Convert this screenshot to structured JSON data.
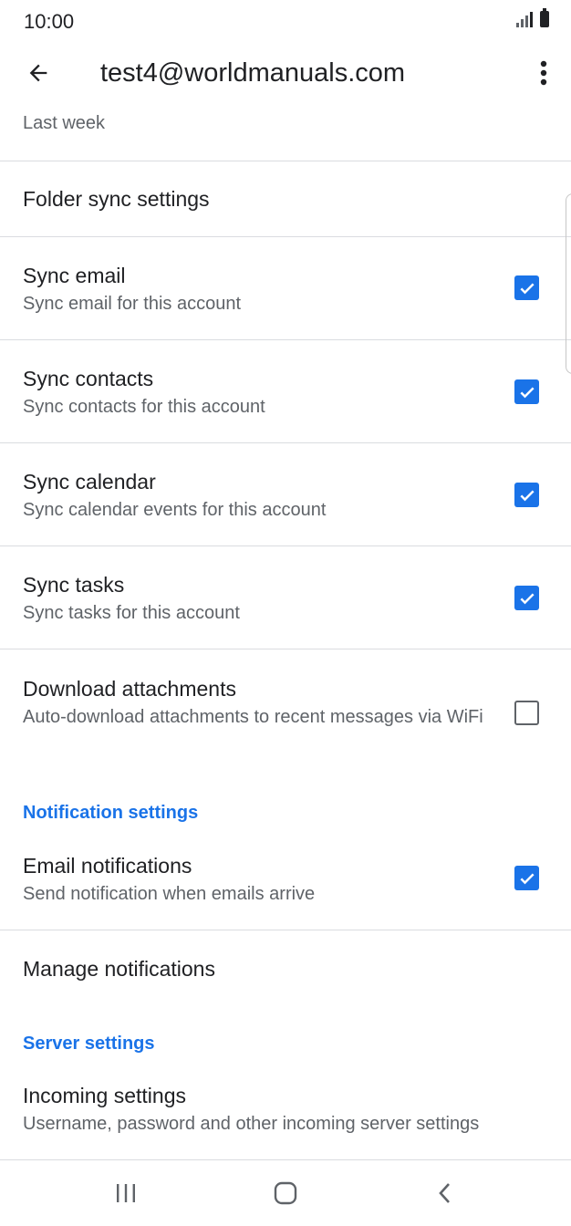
{
  "status_bar": {
    "time": "10:00"
  },
  "app_bar": {
    "title": "test4@worldmanuals.com"
  },
  "partial_value": "Last week",
  "folder_sync": {
    "title": "Folder sync settings"
  },
  "sync_email": {
    "title": "Sync email",
    "subtitle": "Sync email for this account",
    "checked": true
  },
  "sync_contacts": {
    "title": "Sync contacts",
    "subtitle": "Sync contacts for this account",
    "checked": true
  },
  "sync_calendar": {
    "title": "Sync calendar",
    "subtitle": "Sync calendar events for this account",
    "checked": true
  },
  "sync_tasks": {
    "title": "Sync tasks",
    "subtitle": "Sync tasks for this account",
    "checked": true
  },
  "download_attachments": {
    "title": "Download attachments",
    "subtitle": "Auto-download attachments to recent messages via WiFi",
    "checked": false
  },
  "notification_section": {
    "header": "Notification settings"
  },
  "email_notifications": {
    "title": "Email notifications",
    "subtitle": "Send notification when emails arrive",
    "checked": true
  },
  "manage_notifications": {
    "title": "Manage notifications"
  },
  "server_section": {
    "header": "Server settings"
  },
  "incoming_settings": {
    "title": "Incoming settings",
    "subtitle": "Username, password and other incoming server settings"
  },
  "icons": {
    "back": "arrow-back-icon",
    "more": "more-vert-icon",
    "recents": "recent-apps-icon",
    "home": "home-icon",
    "nav_back": "nav-back-icon"
  },
  "colors": {
    "accent": "#1a73e8",
    "text_primary": "#202124",
    "text_secondary": "#5f6368",
    "divider": "#dadce0"
  }
}
